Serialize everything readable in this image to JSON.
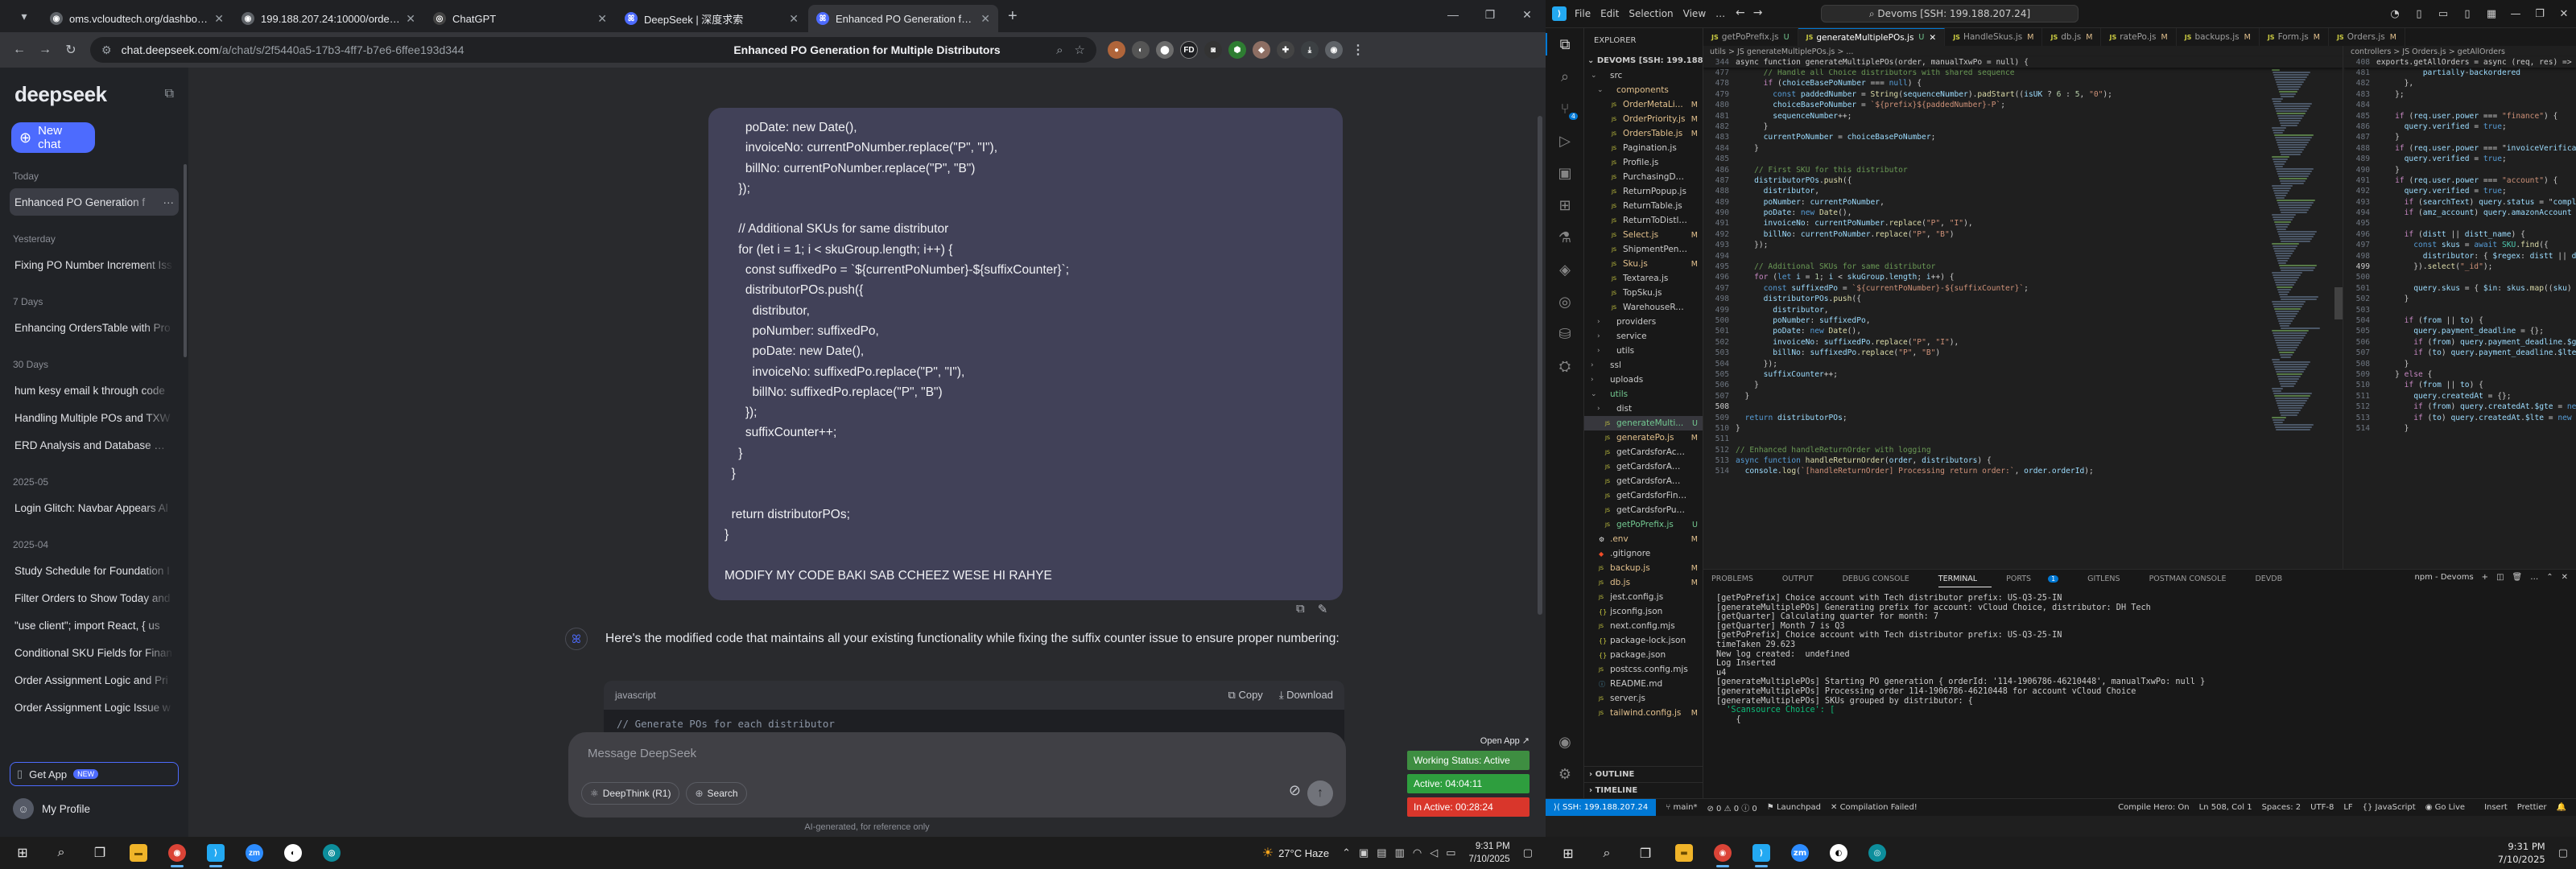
{
  "left": {
    "tabs": [
      {
        "title": "oms.vcloudtech.org/dashboard",
        "color": "#5f6368",
        "glyph": "◉"
      },
      {
        "title": "199.188.207.24:10000/orders/6…",
        "color": "#5f6368",
        "glyph": "◉"
      },
      {
        "title": "ChatGPT",
        "color": "#444",
        "glyph": "◎"
      },
      {
        "title": "DeepSeek | 深度求索",
        "color": "#4d6bfe",
        "glyph": "ꕤ"
      },
      {
        "title": "Enhanced PO Generation for M…",
        "color": "#4d6bfe",
        "glyph": "ꕤ"
      }
    ],
    "url_host": "chat.deepseek.com",
    "url_path": "/a/chat/s/2f5440a5-17b3-4ff7-b7e6-6ffee193d344",
    "sidebar": {
      "logo": "deepseek",
      "new_chat": "New chat",
      "groups": [
        {
          "label": "Today",
          "items": [
            "Enhanced PO Generation f"
          ]
        },
        {
          "label": "Yesterday",
          "items": [
            "Fixing PO Number Increment Iss"
          ]
        },
        {
          "label": "7 Days",
          "items": [
            "Enhancing OrdersTable with Pro"
          ]
        },
        {
          "label": "30 Days",
          "items": [
            "hum kesy email k through code",
            "Handling Multiple POs and TXW",
            "ERD Analysis and Database Mod"
          ]
        },
        {
          "label": "2025-05",
          "items": [
            "Login Glitch: Navbar Appears Al"
          ]
        },
        {
          "label": "2025-04",
          "items": [
            "Study Schedule for Foundation I",
            "Filter Orders to Show Today and",
            "\"use client\"; import React, { us",
            "Conditional SKU Fields for Finan",
            "Order Assignment Logic and Pri",
            "Order Assignment Logic Issue w"
          ]
        }
      ],
      "get_app": "Get App",
      "get_app_badge": "NEW",
      "profile": "My Profile"
    },
    "chat": {
      "title": "Enhanced PO Generation for Multiple Distributors",
      "user_code": "      poDate: new Date(),\n      invoiceNo: currentPoNumber.replace(\"P\", \"I\"),\n      billNo: currentPoNumber.replace(\"P\", \"B\")\n    });\n\n    // Additional SKUs for same distributor\n    for (let i = 1; i < skuGroup.length; i++) {\n      const suffixedPo = `${currentPoNumber}-${suffixCounter}`;\n      distributorPOs.push({\n        distributor,\n        poNumber: suffixedPo,\n        poDate: new Date(),\n        invoiceNo: suffixedPo.replace(\"P\", \"I\"),\n        billNo: suffixedPo.replace(\"P\", \"B\")\n      });\n      suffixCounter++;\n    }\n  }\n\n  return distributorPOs;\n}\n\nMODIFY MY CODE BAKI SAB CCHEEZ WESE HI RAHYE",
      "ai_reply": "Here's the modified code that maintains all your existing functionality while fixing the suffix counter issue to ensure proper numbering:",
      "code_lang": "javascript",
      "copy": "Copy",
      "download": "Download",
      "code_first_line": "// Generate POs for each distributor",
      "composer_placeholder": "Message DeepSeek",
      "deepthink": "DeepThink (R1)",
      "search": "Search",
      "disclaimer": "AI-generated, for reference only"
    },
    "status_widget": {
      "open_app": "Open App ↗",
      "items": [
        {
          "text": "Working Status: Active",
          "color": "#3e8e41"
        },
        {
          "text": "Active: 04:04:11",
          "color": "#2e9e3e"
        },
        {
          "text": "In Active: 00:28:24",
          "color": "#d9362b"
        }
      ]
    },
    "taskbar": {
      "weather_temp": "27°C",
      "weather_desc": "Haze",
      "time": "9:31 PM",
      "date": "7/10/2025"
    }
  },
  "right": {
    "menu": [
      "File",
      "Edit",
      "Selection",
      "View",
      "…"
    ],
    "command_center": "Devoms [SSH: 199.188.207.24]",
    "tabs": [
      {
        "name": "getPoPrefix.js",
        "flag": "U",
        "active": false
      },
      {
        "name": "generateMultiplePOs.js",
        "flag": "U",
        "active": true
      },
      {
        "name": "HandleSkus.js",
        "flag": "M",
        "active": false
      },
      {
        "name": "db.js",
        "flag": "M",
        "active": false
      },
      {
        "name": "ratePo.js",
        "flag": "M",
        "active": false
      },
      {
        "name": "backups.js",
        "flag": "M",
        "active": false
      },
      {
        "name": "Form.js",
        "flag": "M",
        "active": false
      },
      {
        "name": "Orders.js",
        "flag": "M",
        "active": false
      }
    ],
    "explorer_title": "EXPLORER",
    "project": "DEVOMS [SSH: 199.188.20...]",
    "tree": [
      {
        "n": "src",
        "t": "folder",
        "d": 0
      },
      {
        "n": "components",
        "t": "folder",
        "d": 1,
        "c": "#e2c08d"
      },
      {
        "n": "OrderMetaLi...",
        "t": "js",
        "d": 2,
        "s": "M"
      },
      {
        "n": "OrderPriority.js",
        "t": "js",
        "d": 2,
        "s": "M"
      },
      {
        "n": "OrdersTable.js",
        "t": "js",
        "d": 2,
        "s": "M"
      },
      {
        "n": "Pagination.js",
        "t": "js",
        "d": 2
      },
      {
        "n": "Profile.js",
        "t": "js",
        "d": 2
      },
      {
        "n": "PurchasingDashbo...",
        "t": "js",
        "d": 2
      },
      {
        "n": "ReturnPopup.js",
        "t": "js",
        "d": 2
      },
      {
        "n": "ReturnTable.js",
        "t": "js",
        "d": 2
      },
      {
        "n": "ReturnToDistl.js",
        "t": "js",
        "d": 2
      },
      {
        "n": "Select.js",
        "t": "js",
        "d": 2,
        "s": "M"
      },
      {
        "n": "ShipmentPending...",
        "t": "js",
        "d": 2
      },
      {
        "n": "Sku.js",
        "t": "js",
        "d": 2,
        "s": "M"
      },
      {
        "n": "Textarea.js",
        "t": "js",
        "d": 2
      },
      {
        "n": "TopSku.js",
        "t": "js",
        "d": 2
      },
      {
        "n": "WarehouseReturn.js",
        "t": "js",
        "d": 2
      },
      {
        "n": "providers",
        "t": "folder",
        "d": 1
      },
      {
        "n": "service",
        "t": "folder",
        "d": 1
      },
      {
        "n": "utils",
        "t": "folder",
        "d": 1
      },
      {
        "n": "ssl",
        "t": "folder",
        "d": 0
      },
      {
        "n": "uploads",
        "t": "folder",
        "d": 0
      },
      {
        "n": "utils",
        "t": "folder",
        "d": 0,
        "c": "#73c991"
      },
      {
        "n": "dist",
        "t": "folder",
        "d": 1
      },
      {
        "n": "generateMulti...",
        "t": "js",
        "d": 1,
        "s": "U",
        "sel": true
      },
      {
        "n": "generatePo.js",
        "t": "js",
        "d": 1,
        "s": "M"
      },
      {
        "n": "getCardsforAccount.js",
        "t": "js",
        "d": 1
      },
      {
        "n": "getCardsforAm...",
        "t": "js",
        "d": 1
      },
      {
        "n": "getCardsforAmazon.js",
        "t": "js",
        "d": 1
      },
      {
        "n": "getCardsforFinance.js",
        "t": "js",
        "d": 1
      },
      {
        "n": "getCardsforPurchasi...",
        "t": "js",
        "d": 1
      },
      {
        "n": "getPoPrefix.js",
        "t": "js",
        "d": 1,
        "s": "U"
      },
      {
        "n": ".env",
        "t": "env",
        "d": 0,
        "s": "M"
      },
      {
        "n": ".gitignore",
        "t": "git",
        "d": 0
      },
      {
        "n": "backup.js",
        "t": "js",
        "d": 0,
        "s": "M"
      },
      {
        "n": "db.js",
        "t": "js",
        "d": 0,
        "s": "M"
      },
      {
        "n": "jest.config.js",
        "t": "js",
        "d": 0
      },
      {
        "n": "jsconfig.json",
        "t": "json",
        "d": 0
      },
      {
        "n": "next.config.mjs",
        "t": "js",
        "d": 0
      },
      {
        "n": "package-lock.json",
        "t": "json",
        "d": 0
      },
      {
        "n": "package.json",
        "t": "json",
        "d": 0
      },
      {
        "n": "postcss.config.mjs",
        "t": "js",
        "d": 0
      },
      {
        "n": "README.md",
        "t": "md",
        "d": 0
      },
      {
        "n": "server.js",
        "t": "js",
        "d": 0
      },
      {
        "n": "tailwind.config.js",
        "t": "js",
        "d": 0,
        "s": "M"
      }
    ],
    "outline": "OUTLINE",
    "timeline": "TIMELINE",
    "left_breadcrumb": "utils > JS generateMultiplePOs.js > ...",
    "left_sticky_ln": "344",
    "left_sticky": "async function generateMultiplePOs(order, manualTxwPo = null) {",
    "left_code": [
      [
        "477",
        "      // Handle all Choice distributors with shared sequence"
      ],
      [
        "478",
        "      if (choiceBasePoNumber === null) {"
      ],
      [
        "479",
        "        const paddedNumber = String(sequenceNumber).padStart((isUK ? 6 : 5, \"0\");"
      ],
      [
        "480",
        "        choiceBasePoNumber = `${prefix}${paddedNumber}-P`;"
      ],
      [
        "481",
        "        sequenceNumber++;"
      ],
      [
        "482",
        "      }"
      ],
      [
        "483",
        "      currentPoNumber = choiceBasePoNumber;"
      ],
      [
        "484",
        "    }"
      ],
      [
        "485",
        ""
      ],
      [
        "486",
        "    // First SKU for this distributor"
      ],
      [
        "487",
        "    distributorPOs.push({"
      ],
      [
        "488",
        "      distributor,"
      ],
      [
        "489",
        "      poNumber: currentPoNumber,"
      ],
      [
        "490",
        "      poDate: new Date(),"
      ],
      [
        "491",
        "      invoiceNo: currentPoNumber.replace(\"P\", \"I\"),"
      ],
      [
        "492",
        "      billNo: currentPoNumber.replace(\"P\", \"B\")"
      ],
      [
        "493",
        "    });"
      ],
      [
        "494",
        ""
      ],
      [
        "495",
        "    // Additional SKUs for same distributor"
      ],
      [
        "496",
        "    for (let i = 1; i < skuGroup.length; i++) {"
      ],
      [
        "497",
        "      const suffixedPo = `${currentPoNumber}-${suffixCounter}`;"
      ],
      [
        "498",
        "      distributorPOs.push({"
      ],
      [
        "499",
        "        distributor,"
      ],
      [
        "500",
        "        poNumber: suffixedPo,"
      ],
      [
        "501",
        "        poDate: new Date(),"
      ],
      [
        "502",
        "        invoiceNo: suffixedPo.replace(\"P\", \"I\"),"
      ],
      [
        "503",
        "        billNo: suffixedPo.replace(\"P\", \"B\")"
      ],
      [
        "504",
        "      });"
      ],
      [
        "505",
        "      suffixCounter++;"
      ],
      [
        "506",
        "    }"
      ],
      [
        "507",
        "  }"
      ],
      [
        "508",
        ""
      ],
      [
        "509",
        "  return distributorPOs;"
      ],
      [
        "510",
        "}"
      ],
      [
        "511",
        ""
      ],
      [
        "512",
        "// Enhanced handleReturnOrder with logging"
      ],
      [
        "513",
        "async function handleReturnOrder(order, distributors) {"
      ],
      [
        "514",
        "  console.log(`[handleReturnOrder] Processing return order:`, order.orderId);"
      ]
    ],
    "right_breadcrumb": "controllers > JS Orders.js > getAllOrders",
    "right_sticky_ln": "408",
    "right_sticky": "exports.getAllOrders = async (req, res) => {",
    "right_code": [
      [
        "481",
        "          partially-backordered"
      ],
      [
        "482",
        "      },"
      ],
      [
        "483",
        "    };"
      ],
      [
        "484",
        ""
      ],
      [
        "485",
        "    if (req.user.power === \"finance\") {"
      ],
      [
        "486",
        "      query.verified = true;"
      ],
      [
        "487",
        "    }"
      ],
      [
        "488",
        "    if (req.user.power === \"invoiceVerification"
      ],
      [
        "489",
        "      query.verified = true;"
      ],
      [
        "490",
        "    }"
      ],
      [
        "491",
        "    if (req.user.power === \"account\") {"
      ],
      [
        "492",
        "      query.verified = true;"
      ],
      [
        "493",
        "      if (searchText) query.status = \"complet"
      ],
      [
        "494",
        "      if (amz_account) query.amazonAccount = e"
      ],
      [
        "495",
        ""
      ],
      [
        "496",
        "      if (distt || distt_name) {"
      ],
      [
        "497",
        "        const skus = await SKU.find({"
      ],
      [
        "498",
        "          distributor: { $regex: distt || dist"
      ],
      [
        "499",
        "        }).select(\"_id\");"
      ],
      [
        "500",
        ""
      ],
      [
        "501",
        "        query.skus = { $in: skus.map((sku) => s"
      ],
      [
        "502",
        "      }"
      ],
      [
        "503",
        ""
      ],
      [
        "504",
        "      if (from || to) {"
      ],
      [
        "505",
        "        query.payment_deadline = {};"
      ],
      [
        "506",
        "        if (from) query.payment_deadline.$gte ="
      ],
      [
        "507",
        "        if (to) query.payment_deadline.$lte ="
      ],
      [
        "508",
        "      }"
      ],
      [
        "509",
        "    } else {"
      ],
      [
        "510",
        "      if (from || to) {"
      ],
      [
        "511",
        "        query.createdAt = {};"
      ],
      [
        "512",
        "        if (from) query.createdAt.$gte = new D"
      ],
      [
        "513",
        "        if (to) query.createdAt.$lte = new Dat"
      ],
      [
        "514",
        "      }"
      ]
    ],
    "panel_tabs": [
      "PROBLEMS",
      "OUTPUT",
      "DEBUG CONSOLE",
      "TERMINAL",
      "PORTS",
      "GITLENS",
      "POSTMAN CONSOLE",
      "DEVDB"
    ],
    "ports_badge": "1",
    "terminal_label": "npm - Devoms",
    "terminal": [
      "[getPoPrefix] Choice account with Tech distributor prefix: US-Q3-25-IN",
      "[generateMultiplePOs] Generating prefix for account: vCloud Choice, distributor: DH Tech",
      "[getQuarter] Calculating quarter for month: 7",
      "[getQuarter] Month 7 is Q3",
      "[getPoPrefix] Choice account with Tech distributor prefix: US-Q3-25-IN",
      "timeTaken 29.623",
      "New log created:  undefined",
      "Log Inserted",
      "u4",
      "[generateMultiplePOs] Starting PO generation { orderId: '114-1906786-46210448', manualTxwPo: null }",
      "[generateMultiplePOs] Processing order 114-1906786-46210448 for account vCloud Choice",
      "[generateMultiplePOs] SKUs grouped by distributor: {",
      "  'Scansource Choice': [",
      "    {"
    ],
    "status_bar": {
      "remote": "SSH: 199.188.207.24",
      "branch": "main*",
      "sync": "⊘ 0 ⚠ 0 ⓘ 0",
      "launchpad": "Launchpad",
      "compilation": "Compilation Failed!",
      "compile_hero": "Compile Hero: On",
      "position": "Ln 508, Col 1",
      "spaces": "Spaces: 2",
      "encoding": "UTF-8",
      "eol": "LF",
      "lang": "{} JavaScript",
      "golive": "Go Live",
      "insert": "Insert",
      "prettier": "Prettier"
    },
    "taskbar_time": "9:31 PM",
    "taskbar_date": "7/10/2025"
  }
}
